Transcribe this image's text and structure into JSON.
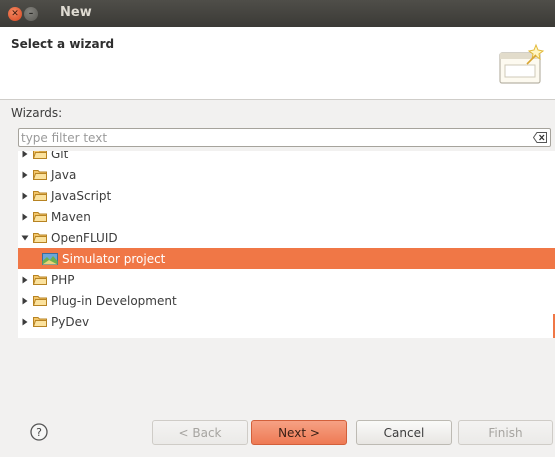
{
  "window": {
    "title": "New",
    "close_glyph": "✕",
    "minimize_glyph": "–"
  },
  "header": {
    "title": "Select a wizard",
    "icon": "wizard-banner-icon"
  },
  "wizards_label": "Wizards:",
  "filter": {
    "placeholder": "type filter text",
    "value": ""
  },
  "tree": {
    "items": [
      {
        "label": "Git",
        "expanded": false
      },
      {
        "label": "Java",
        "expanded": false
      },
      {
        "label": "JavaScript",
        "expanded": false
      },
      {
        "label": "Maven",
        "expanded": false
      },
      {
        "label": "OpenFLUID",
        "expanded": true
      },
      {
        "label": "Simulator project",
        "child": true,
        "selected": true
      },
      {
        "label": "PHP",
        "expanded": false
      },
      {
        "label": "Plug-in Development",
        "expanded": false
      },
      {
        "label": "PyDev",
        "expanded": false
      }
    ]
  },
  "buttons": {
    "help": "?",
    "back": "< Back",
    "next": "Next >",
    "cancel": "Cancel",
    "finish": "Finish"
  },
  "colors": {
    "accent": "#f07746",
    "titlebar": "#3b3a36",
    "folder": "#e8b14a"
  }
}
